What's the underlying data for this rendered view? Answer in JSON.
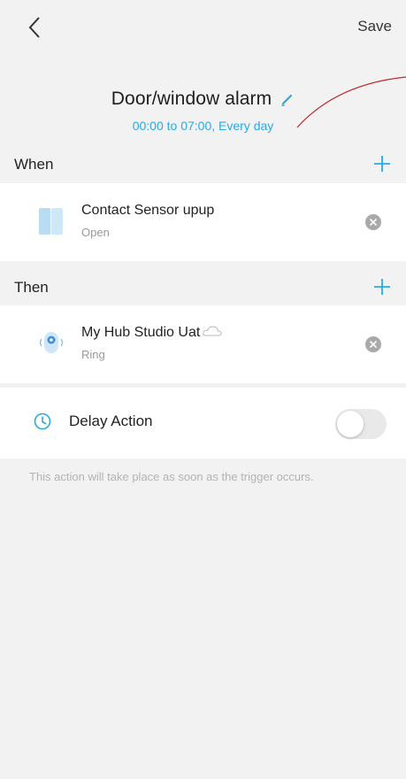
{
  "header": {
    "save_label": "Save"
  },
  "automation": {
    "title": "Door/window alarm",
    "schedule": "00:00 to 07:00, Every day"
  },
  "when_section": {
    "label": "When",
    "items": [
      {
        "title": "Contact Sensor upup",
        "subtitle": "Open",
        "icon": "contact-sensor-icon"
      }
    ]
  },
  "then_section": {
    "label": "Then",
    "items": [
      {
        "title": "My Hub Studio Uat",
        "subtitle": "Ring",
        "icon": "hub-icon",
        "badge_icon": "cloud-icon"
      }
    ]
  },
  "delay": {
    "label": "Delay Action",
    "enabled": false
  },
  "note": "This action will take place as soon as the trigger occurs.",
  "colors": {
    "accent": "#29a9e8",
    "annotation": "#c0282a",
    "background": "#f2f2f2"
  }
}
